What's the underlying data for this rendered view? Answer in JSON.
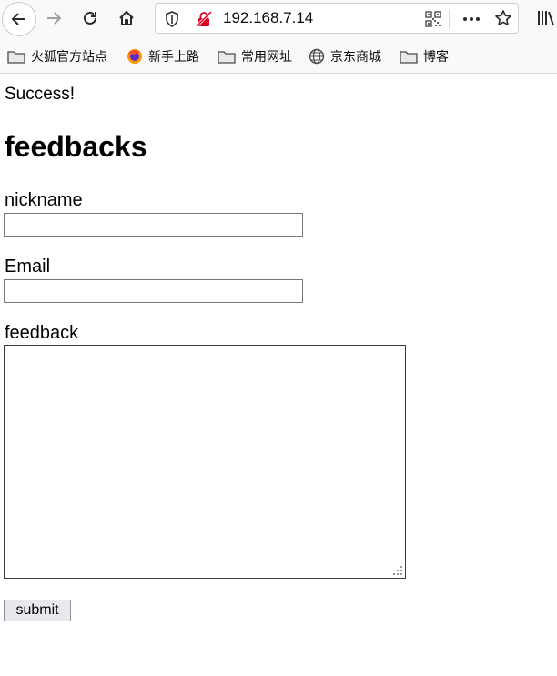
{
  "browser": {
    "url": "192.168.7.14",
    "bookmarks": [
      {
        "label": "火狐官方站点",
        "icon": "folder-icon"
      },
      {
        "label": "新手上路",
        "icon": "firefox-icon"
      },
      {
        "label": "常用网址",
        "icon": "folder-icon"
      },
      {
        "label": "京东商城",
        "icon": "globe-icon"
      },
      {
        "label": "博客",
        "icon": "folder-icon"
      }
    ]
  },
  "page": {
    "status": "Success!",
    "title": "feedbacks",
    "nickname_label": "nickname",
    "nickname_value": "",
    "email_label": "Email",
    "email_value": "",
    "feedback_label": "feedback",
    "feedback_value": "",
    "submit_label": "submit"
  },
  "colors": {
    "toolbar_bg": "#f9f9fa",
    "insecure_icon": "#d70022"
  }
}
